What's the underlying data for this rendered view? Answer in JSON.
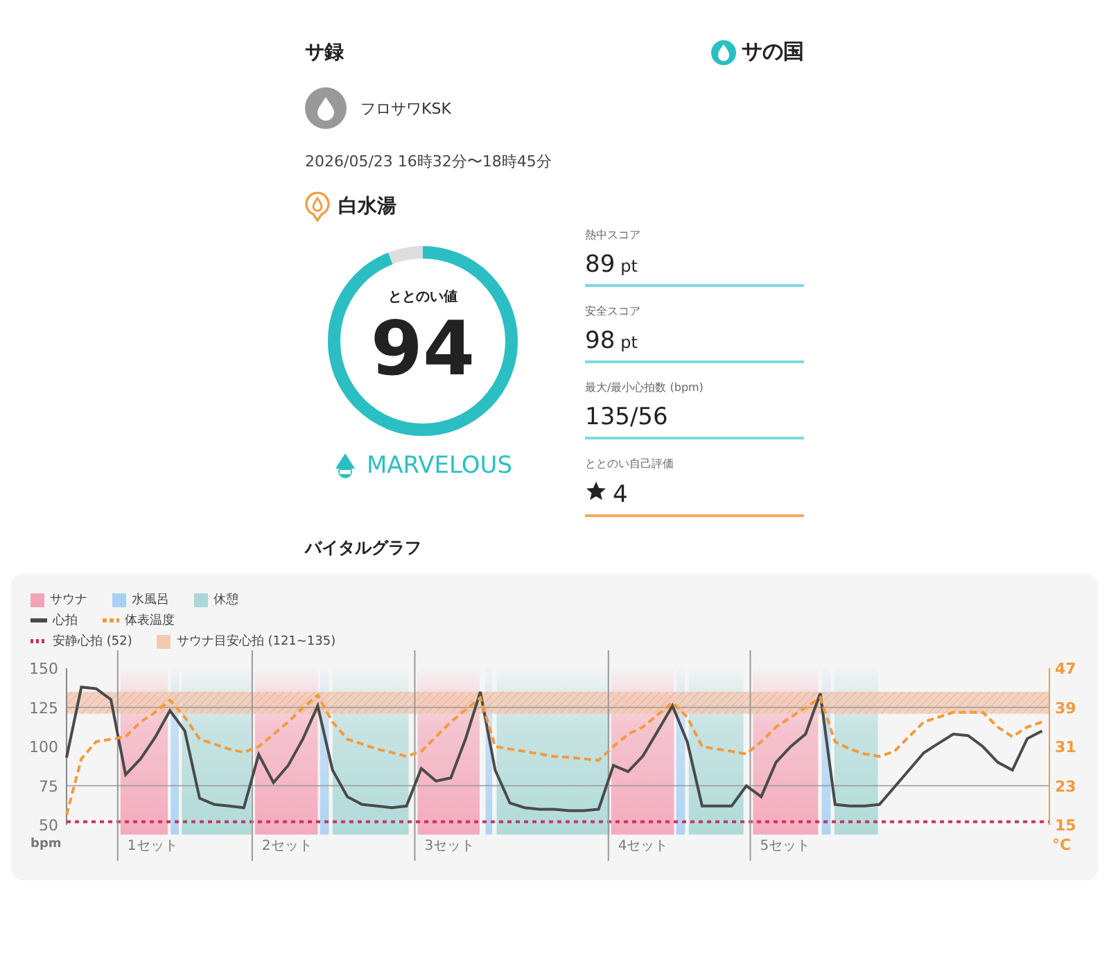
{
  "header": {
    "title": "サ録",
    "logo": "サの国"
  },
  "user": {
    "name": "フロサワKSK"
  },
  "datetime": "2026/05/23 16時32分〜18時45分",
  "facility": {
    "name": "白水湯"
  },
  "score": {
    "label": "ととのい値",
    "value": "94",
    "level": 0.94,
    "rank": "MARVELOUS"
  },
  "stats": [
    {
      "kind": "score",
      "label": "熱中スコア",
      "value": "89",
      "unit": "pt"
    },
    {
      "kind": "score",
      "label": "安全スコア",
      "value": "98",
      "unit": "pt"
    },
    {
      "kind": "score",
      "label": "最大/最小心拍数 (bpm)",
      "value": "135/56"
    },
    {
      "kind": "rating",
      "label": "ととのい自己評価",
      "value": "4"
    }
  ],
  "vital": {
    "title": "バイタルグラフ",
    "legend": [
      {
        "kind": "sauna",
        "label": "サウナ",
        "color": "#f4a3b7"
      },
      {
        "kind": "water",
        "label": "水風呂",
        "color": "#a8d0f4"
      },
      {
        "kind": "rest",
        "label": "休憩",
        "color": "#a9d8d6"
      },
      {
        "kind": "resting",
        "label": "安静心拍 (52)",
        "color": "#c8325a"
      },
      {
        "kind": "zone",
        "label": "サウナ目安心拍 (121~135)",
        "color": "#f3c9b3"
      }
    ],
    "sets": [
      {
        "label": "1セット"
      },
      {
        "label": "2セット"
      },
      {
        "label": "3セット"
      },
      {
        "label": "4セット"
      },
      {
        "label": "5セット"
      }
    ],
    "heart_chart": {
      "chart_data": {
        "type": "line",
        "ylabel": "bpm",
        "grid": true,
        "categories": [
          null,
          null,
          null,
          null,
          null,
          null,
          null,
          null,
          null,
          null,
          null,
          null,
          null,
          null,
          null,
          null,
          null,
          null,
          null,
          null,
          null,
          null,
          null,
          null,
          null,
          null,
          null,
          null,
          null,
          null,
          null,
          null,
          null,
          null,
          null,
          null,
          null,
          null,
          null,
          null,
          null,
          null,
          null,
          null,
          null,
          null,
          null,
          null,
          null,
          null,
          null,
          null,
          null,
          null,
          null,
          null,
          null,
          null,
          null,
          null,
          null,
          null,
          null,
          null,
          null,
          null,
          null
        ],
        "ylim": [
          50,
          150
        ],
        "yticks": [
          50,
          75,
          100,
          125,
          150
        ],
        "series": [
          {
            "name": "心拍",
            "color": "#4a4a4a",
            "line_style": "solid",
            "values": [
              93,
              138,
              137,
              130,
              82,
              92,
              106,
              123,
              110,
              67,
              63,
              62,
              61,
              95,
              77,
              88,
              105,
              126,
              85,
              68,
              63,
              62,
              61,
              62,
              86,
              78,
              80,
              105,
              135,
              85,
              64,
              61,
              60,
              60,
              59,
              59,
              60,
              88,
              84,
              94,
              110,
              126,
              103,
              62,
              62,
              62,
              75,
              68,
              90,
              100,
              108,
              134,
              63,
              62,
              62,
              63,
              74,
              85,
              96,
              102,
              108,
              107,
              100,
              90,
              85,
              105,
              110
            ]
          }
        ],
        "bands": [
          {
            "axis": "y",
            "from": 121,
            "to": 135,
            "color": "#f3c9b3"
          }
        ],
        "ref_lines": [
          {
            "axis": "y",
            "value": 52,
            "color": "#c8325a"
          }
        ]
      }
    },
    "temp_chart": {
      "chart_data": {
        "type": "line",
        "ylabel": "°C",
        "categories": [
          null,
          null,
          null,
          null,
          null,
          null,
          null,
          null,
          null,
          null,
          null,
          null,
          null,
          null,
          null,
          null,
          null,
          null,
          null,
          null,
          null,
          null,
          null,
          null,
          null,
          null,
          null,
          null,
          null,
          null,
          null,
          null,
          null,
          null,
          null,
          null,
          null,
          null,
          null,
          null,
          null,
          null,
          null,
          null,
          null,
          null,
          null,
          null,
          null,
          null,
          null,
          null,
          null,
          null,
          null,
          null,
          null,
          null,
          null,
          null,
          null,
          null,
          null,
          null,
          null,
          null,
          null
        ],
        "ylim": [
          15,
          47
        ],
        "yticks": [
          15,
          23,
          31,
          39,
          47
        ],
        "series": [
          {
            "name": "体表温度",
            "color": "#f39a3c",
            "line_style": "dashed",
            "values": [
              17,
              28.5,
              32,
              32.5,
              33,
              36,
              38,
              40.5,
              37,
              32.5,
              31.5,
              30.5,
              29.8,
              31,
              33.5,
              36,
              39,
              41.5,
              36,
              32.5,
              31.5,
              30.5,
              29.8,
              29,
              30,
              33,
              36,
              38.5,
              41,
              31,
              30.5,
              30,
              29.5,
              29,
              28.8,
              28.5,
              28.2,
              31,
              33.5,
              35,
              37.5,
              40,
              37,
              31,
              30.5,
              30,
              29.5,
              32,
              35,
              37,
              39,
              41,
              32,
              30.5,
              29.5,
              29,
              30,
              33,
              36,
              37,
              38,
              38,
              38,
              35,
              33,
              35,
              36
            ]
          }
        ]
      }
    }
  }
}
